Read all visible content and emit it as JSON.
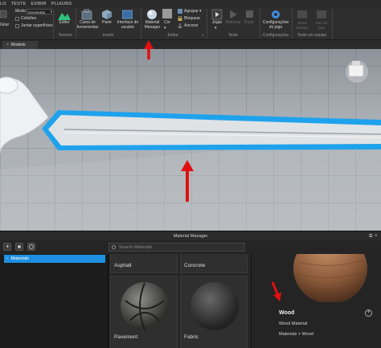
{
  "menu": [
    "LO",
    "TESTE",
    "EXIBIR",
    "PLUGINS"
  ],
  "ribbon": {
    "left_cut": "Girar",
    "mode_label": "Modo:",
    "mode_value": "Geometria",
    "collisions": "Colisões",
    "join_surfaces": "Juntar superfícies",
    "editor": "Editor",
    "toolbox": "Caixa de ferramentas",
    "part": "Parte",
    "ui_interface": "Interface do usuário",
    "material_manager": "Material Manager",
    "color": "Cor",
    "group": "Agrupar",
    "lock": "Bloquear",
    "anchor": "Ancorar",
    "play": "Jogar",
    "resume": "Retomar",
    "stop": "Parar",
    "game_settings": "Configurações do jogo",
    "team_test": "Testar servidor",
    "exit_game": "Sair do jogo",
    "groups": {
      "terrain": "Terreno",
      "insert": "Inserir",
      "edit": "Editar",
      "test": "Teste",
      "settings": "Configurações",
      "team_test": "Teste em equipe"
    }
  },
  "tabs": {
    "models": "Models"
  },
  "material_manager": {
    "title": "Material Manager",
    "search_placeholder": "Search Materials",
    "tree": {
      "materials": "Materials"
    },
    "grid": [
      {
        "name": "Asphalt"
      },
      {
        "name": "Concrete"
      },
      {
        "name": "Pavement"
      },
      {
        "name": "Fabric"
      }
    ],
    "detail": {
      "name": "Wood",
      "subtitle": "Wood Material",
      "path": "Materials > Wood"
    }
  },
  "colors": {
    "highlight_blue": "#1e8fe0",
    "annotation_red": "#e01010"
  }
}
